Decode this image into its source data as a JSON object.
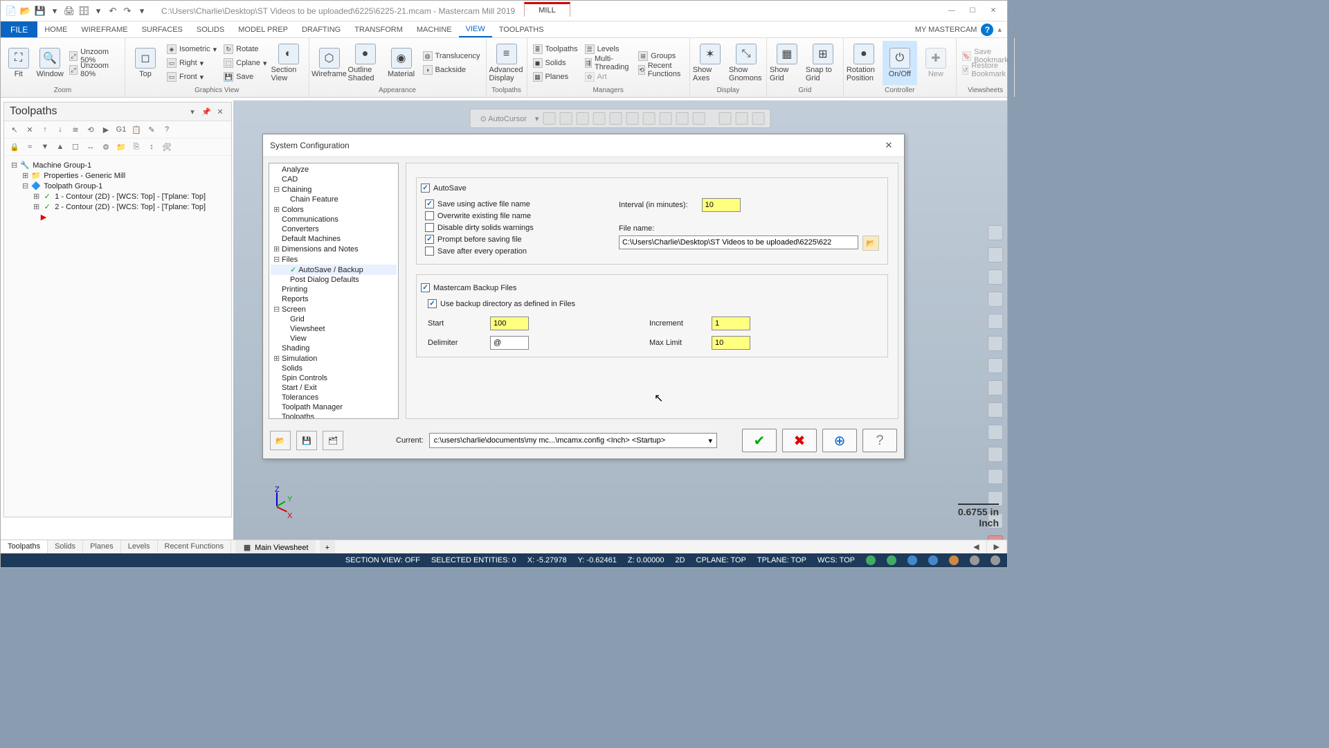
{
  "titlebar": {
    "path": "C:\\Users\\Charlie\\Desktop\\ST Videos to be uploaded\\6225\\6225-21.mcam - Mastercam Mill 2019",
    "context_tab": "MILL"
  },
  "menu": {
    "file": "FILE",
    "items": [
      "HOME",
      "WIREFRAME",
      "SURFACES",
      "SOLIDS",
      "MODEL PREP",
      "DRAFTING",
      "TRANSFORM",
      "MACHINE",
      "VIEW",
      "TOOLPATHS"
    ],
    "active": "VIEW",
    "my": "MY MASTERCAM"
  },
  "ribbon": {
    "zoom": {
      "fit": "Fit",
      "window": "Window",
      "un50": "Unzoom 50%",
      "un80": "Unzoom 80%",
      "label": "Zoom"
    },
    "gview": {
      "top": "Top",
      "iso": "Isometric",
      "right": "Right",
      "front": "Front",
      "rotate": "Rotate",
      "cplane": "Cplane",
      "save": "Save",
      "section": "Section View",
      "label": "Graphics View"
    },
    "appearance": {
      "wire": "Wireframe",
      "outline": "Outline Shaded",
      "material": "Material",
      "trans": "Translucency",
      "back": "Backside",
      "label": "Appearance"
    },
    "toolpaths": {
      "adv": "Advanced Display",
      "label": "Toolpaths"
    },
    "managers": {
      "tp": "Toolpaths",
      "solids": "Solids",
      "planes": "Planes",
      "levels": "Levels",
      "multi": "Multi-Threading",
      "art": "Art",
      "groups": "Groups",
      "recent": "Recent Functions",
      "label": "Managers"
    },
    "display": {
      "axes": "Show Axes",
      "gnomons": "Show Gnomons",
      "label": "Display"
    },
    "grid": {
      "show": "Show Grid",
      "snap": "Snap to Grid",
      "label": "Grid"
    },
    "controller": {
      "rot": "Rotation Position",
      "onoff": "On/Off",
      "new": "New",
      "label": "Controller"
    },
    "viewsheets": {
      "savebm": "Save Bookmark",
      "restore": "Restore Bookmark",
      "label": "Viewsheets"
    }
  },
  "panel": {
    "title": "Toolpaths",
    "tree": {
      "root": "Machine Group-1",
      "props": "Properties - Generic Mill",
      "tg": "Toolpath Group-1",
      "op1": "1 - Contour (2D) - [WCS: Top] - [Tplane: Top]",
      "op2": "2 - Contour (2D) - [WCS: Top] - [Tplane: Top]"
    }
  },
  "dialog": {
    "title": "System Configuration",
    "tree": [
      "Analyze",
      "CAD",
      "Chaining",
      "Chain Feature",
      "Colors",
      "Communications",
      "Converters",
      "Default Machines",
      "Dimensions and Notes",
      "Files",
      "AutoSave / Backup",
      "Post Dialog Defaults",
      "Printing",
      "Reports",
      "Screen",
      "Grid",
      "Viewsheet",
      "View",
      "Shading",
      "Simulation",
      "Solids",
      "Spin Controls",
      "Start / Exit",
      "Tolerances",
      "Toolpath Manager",
      "Toolpaths"
    ],
    "autosave": {
      "enable": "AutoSave",
      "active": "Save using active file name",
      "overwrite": "Overwrite existing file name",
      "dirty": "Disable dirty solids warnings",
      "prompt": "Prompt before saving file",
      "after": "Save after every operation",
      "interval_lbl": "Interval (in minutes):",
      "interval": "10",
      "filename_lbl": "File name:",
      "filename": "C:\\Users\\Charlie\\Desktop\\ST Videos to be uploaded\\6225\\622"
    },
    "backup": {
      "enable": "Mastercam Backup Files",
      "usedir": "Use backup directory as defined in Files",
      "start_lbl": "Start",
      "start": "100",
      "delim_lbl": "Delimiter",
      "delim": "@",
      "inc_lbl": "Increment",
      "inc": "1",
      "max_lbl": "Max Limit",
      "max": "10"
    },
    "current_lbl": "Current:",
    "current": "c:\\users\\charlie\\documents\\my mc...\\mcamx.config <Inch> <Startup>"
  },
  "bottom_tabs": [
    "Toolpaths",
    "Solids",
    "Planes",
    "Levels",
    "Recent Functions"
  ],
  "viewsheet_tab": "Main Viewsheet",
  "scale": {
    "val": "0.6755 in",
    "unit": "Inch"
  },
  "status": {
    "section": "SECTION VIEW: OFF",
    "sel": "SELECTED ENTITIES: 0",
    "x": "X: -5.27978",
    "y": "Y: -0.62461",
    "z": "Z: 0.00000",
    "dim": "2D",
    "cplane": "CPLANE: TOP",
    "tplane": "TPLANE: TOP",
    "wcs": "WCS: TOP"
  }
}
